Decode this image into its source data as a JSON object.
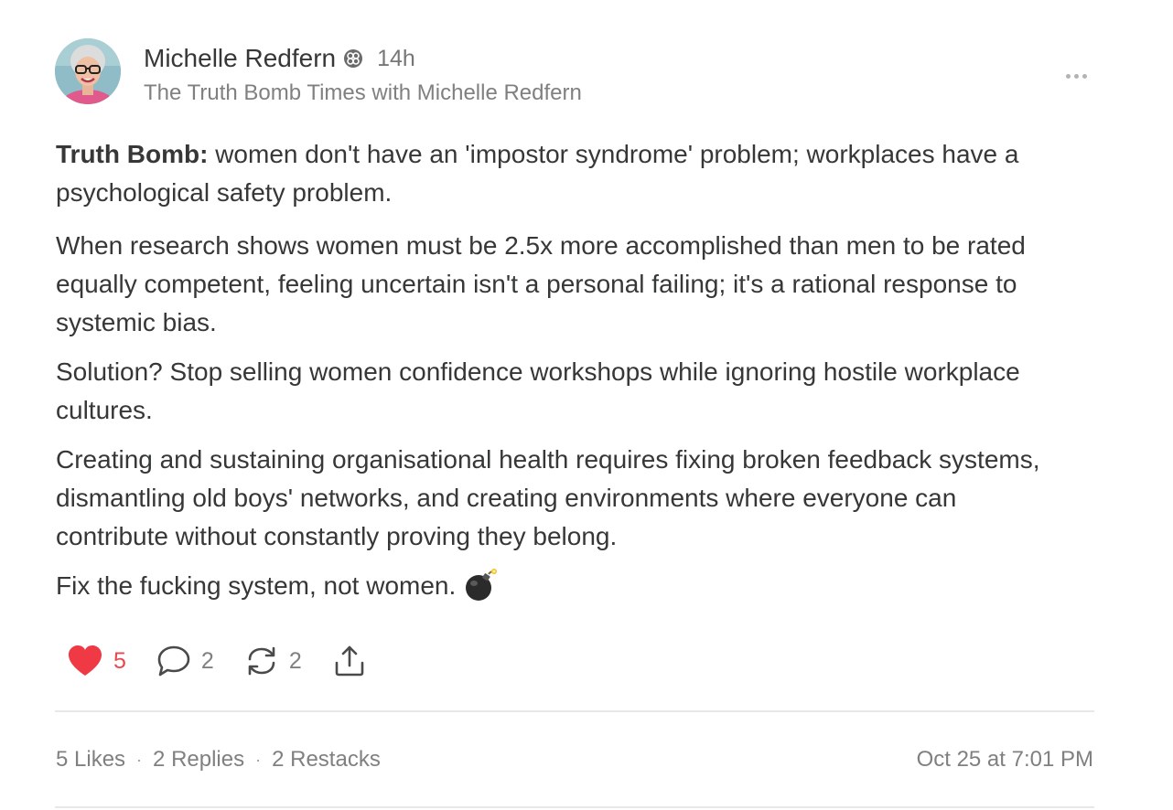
{
  "author": {
    "name": "Michelle Redfern",
    "time_ago": "14h",
    "publication": "The Truth Bomb Times with Michelle Redfern",
    "avatar": "avatar-photo"
  },
  "menu_icon": "more-dots-icon",
  "post": {
    "p1_bold": "Truth Bomb:",
    "p1_rest": " women don't have an 'impostor syndrome' problem; workplaces have a psychological safety problem.",
    "p2": "When research shows women must be 2.5x more accomplished than men to be rated equally competent, feeling uncertain isn't a personal failing; it's a rational response to systemic bias.",
    "p3": "Solution? Stop selling women confidence workshops while ignoring hostile workplace cultures.",
    "p4": "Creating and sustaining organisational health requires fixing broken feedback systems, dismantling old boys' networks, and creating environments where everyone can contribute without constantly proving they belong.",
    "p5": "Fix the fucking system, not women.",
    "emoji": "bomb-icon"
  },
  "actions": {
    "likes": "5",
    "replies": "2",
    "restacks": "2",
    "icons": [
      "heart-icon",
      "comment-icon",
      "restack-icon",
      "share-icon"
    ]
  },
  "stats": {
    "likes": "5 Likes",
    "separator": "·",
    "replies": "2 Replies",
    "restacks": "2 Restacks",
    "date": "Oct 25 at 7:01 PM"
  },
  "colors": {
    "like_red": "#e8484f",
    "text": "#363737",
    "muted": "#808080",
    "divider": "#e8e8e8"
  }
}
